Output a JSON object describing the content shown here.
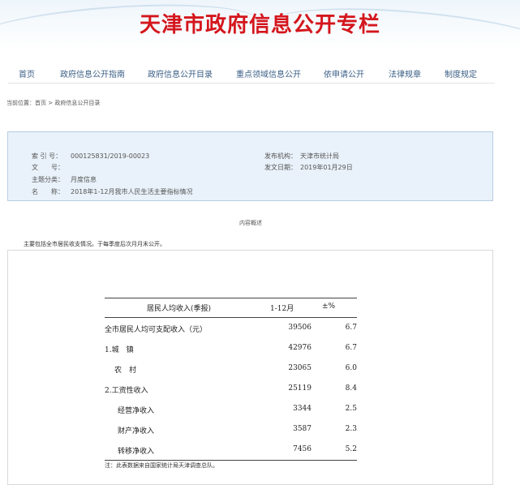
{
  "site": {
    "title": "天津市政府信息公开专栏"
  },
  "nav": {
    "items": [
      {
        "label": "首页"
      },
      {
        "label": "政府信息公开指南"
      },
      {
        "label": "政府信息公开目录"
      },
      {
        "label": "重点领域信息公开"
      },
      {
        "label": "依申请公开"
      },
      {
        "label": "法律规章"
      },
      {
        "label": "制度规定"
      }
    ]
  },
  "breadcrumb": "当前位置：首页 > 政府信息公开目录",
  "meta": {
    "index_label": "索 引 号：",
    "index_value": "000125831/2019-00023",
    "doc_label": "文　　号：",
    "doc_value": "",
    "category_label": "主题分类：",
    "category_value": "月度信息",
    "name_label": "名　　称：",
    "name_value": "2018年1-12月我市人民生活主要指标情况",
    "publisher_label": "发布机构：",
    "publisher_value": "天津市统计局",
    "date_label": "发文日期：",
    "date_value": "2019年01月29日"
  },
  "summary": {
    "heading": "内容概述",
    "text": "主要包括全市居民收支情况。于每季度后次月月末公开。"
  },
  "table": {
    "header": {
      "title": "居民人均收入(季报)",
      "period": "1-12月",
      "change": "±%"
    },
    "rows": [
      {
        "label": "全市居民人均可支配收入（元）",
        "value": "39506",
        "pct": "6.7"
      },
      {
        "label": "1.城　镇",
        "value": "42976",
        "pct": "6.7"
      },
      {
        "label": "农　村",
        "value": "23065",
        "pct": "6.0"
      },
      {
        "label": "2.工资性收入",
        "value": "25119",
        "pct": "8.4"
      },
      {
        "label": "经营净收入",
        "value": "3344",
        "pct": "2.5"
      },
      {
        "label": "财产净收入",
        "value": "3587",
        "pct": "2.3"
      },
      {
        "label": "转移净收入",
        "value": "7456",
        "pct": "5.2"
      }
    ],
    "note": "注：此表数据来自国家统计局天津调查总队。"
  }
}
